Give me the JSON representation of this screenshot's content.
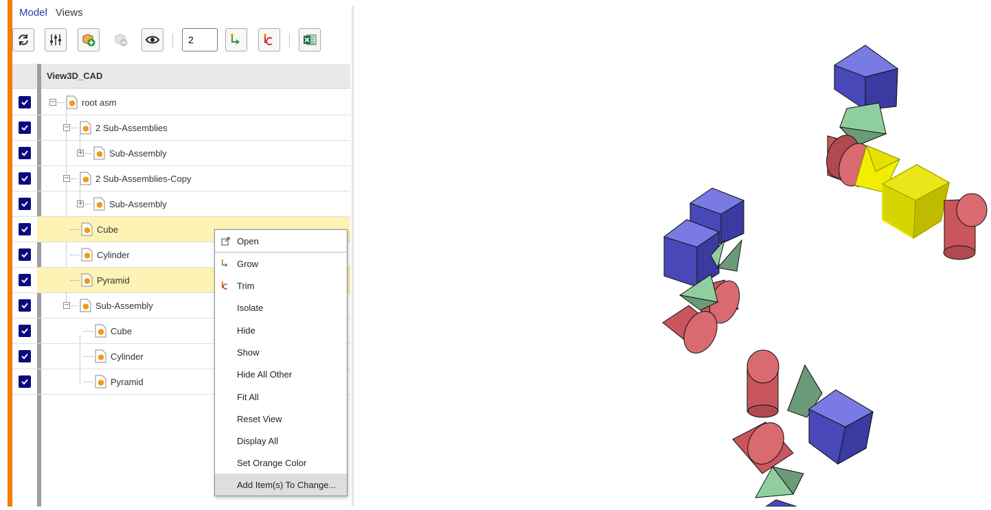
{
  "tabs": [
    "Model",
    "Views"
  ],
  "toolbar": {
    "level_value": "2",
    "buttons": [
      {
        "name": "refresh-icon"
      },
      {
        "name": "settings-sliders-icon"
      },
      {
        "name": "add-part-icon"
      },
      {
        "name": "remove-part-icon"
      },
      {
        "name": "eye-icon"
      },
      {
        "name": "grow-icon"
      },
      {
        "name": "trim-icon"
      },
      {
        "name": "excel-export-icon"
      }
    ]
  },
  "tree": {
    "column_header": "View3D_CAD",
    "rows": [
      {
        "label": "root asm",
        "checked": true
      },
      {
        "label": "2 Sub-Assemblies",
        "checked": true
      },
      {
        "label": "Sub-Assembly",
        "checked": true
      },
      {
        "label": "2 Sub-Assemblies-Copy",
        "checked": true
      },
      {
        "label": "Sub-Assembly",
        "checked": true
      },
      {
        "label": "Cube",
        "checked": true,
        "selected": true
      },
      {
        "label": "Cylinder",
        "checked": true
      },
      {
        "label": "Pyramid",
        "checked": true,
        "selected": true
      },
      {
        "label": "Sub-Assembly",
        "checked": true
      },
      {
        "label": "Cube",
        "checked": true
      },
      {
        "label": "Cylinder",
        "checked": true
      },
      {
        "label": "Pyramid",
        "checked": true
      }
    ]
  },
  "context_menu": {
    "items": [
      {
        "label": "Open",
        "icon": "open-external-icon"
      },
      {
        "label": "Grow",
        "icon": "grow-icon"
      },
      {
        "label": "Trim",
        "icon": "trim-icon"
      },
      {
        "label": "Isolate"
      },
      {
        "label": "Hide"
      },
      {
        "label": "Show"
      },
      {
        "label": "Hide All Other"
      },
      {
        "label": "Fit All"
      },
      {
        "label": "Reset View"
      },
      {
        "label": "Display All"
      },
      {
        "label": "Set Orange Color"
      },
      {
        "label": "Add Item(s) To Change..."
      }
    ],
    "hovered_item": "Add Item(s) To Change..."
  },
  "colors": {
    "accent_orange": "#f27d00",
    "checkbox": "#0a0a80",
    "selection": "#fdf3b4",
    "cube": "#5a5ad0",
    "cylinder": "#d86a70",
    "pyramid": "#8fcf9f",
    "highlight_part": "#e6e000"
  }
}
